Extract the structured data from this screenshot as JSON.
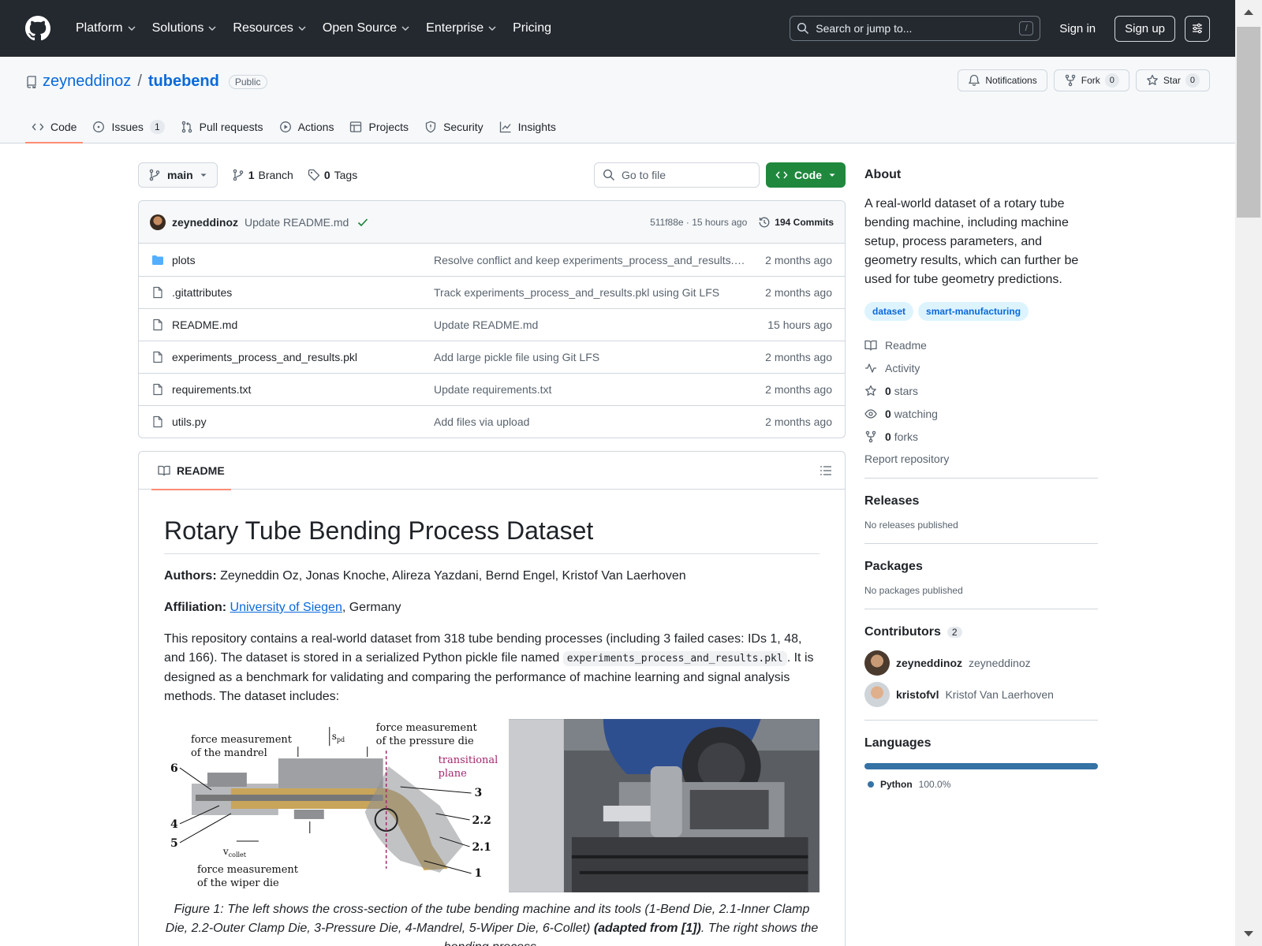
{
  "header": {
    "nav": [
      "Platform",
      "Solutions",
      "Resources",
      "Open Source",
      "Enterprise",
      "Pricing"
    ],
    "search_placeholder": "Search or jump to...",
    "slash": "/",
    "signin": "Sign in",
    "signup": "Sign up"
  },
  "repo": {
    "owner": "zeyneddinoz",
    "separator": "/",
    "name": "tubebend",
    "visibility": "Public",
    "actions": {
      "notifications": "Notifications",
      "fork": "Fork",
      "fork_count": "0",
      "star": "Star",
      "star_count": "0"
    },
    "tabs": [
      {
        "label": "Code"
      },
      {
        "label": "Issues",
        "count": "1"
      },
      {
        "label": "Pull requests"
      },
      {
        "label": "Actions"
      },
      {
        "label": "Projects"
      },
      {
        "label": "Security"
      },
      {
        "label": "Insights"
      }
    ]
  },
  "toolbar": {
    "branch": "main",
    "branches_count": "1",
    "branches_label": "Branch",
    "tags_count": "0",
    "tags_label": "Tags",
    "goto_placeholder": "Go to file",
    "code_label": "Code"
  },
  "commit": {
    "author": "zeyneddinoz",
    "message": "Update README.md",
    "hash_time": "511f88e · 15 hours ago",
    "commits_label": "194 Commits"
  },
  "files": [
    {
      "name": "plots",
      "type": "folder",
      "message": "Resolve conflict and keep experiments_process_and_results.pkl from remote",
      "date": "2 months ago"
    },
    {
      "name": ".gitattributes",
      "type": "file",
      "message": "Track experiments_process_and_results.pkl using Git LFS",
      "date": "2 months ago"
    },
    {
      "name": "README.md",
      "type": "file",
      "message": "Update README.md",
      "date": "15 hours ago"
    },
    {
      "name": "experiments_process_and_results.pkl",
      "type": "file",
      "message": "Add large pickle file using Git LFS",
      "date": "2 months ago"
    },
    {
      "name": "requirements.txt",
      "type": "file",
      "message": "Update requirements.txt",
      "date": "2 months ago"
    },
    {
      "name": "utils.py",
      "type": "file",
      "message": "Add files via upload",
      "date": "2 months ago"
    }
  ],
  "readme": {
    "tab": "README",
    "title": "Rotary Tube Bending Process Dataset",
    "authors_label": "Authors:",
    "authors": " Zeyneddin Oz, Jonas Knoche, Alireza Yazdani, Bernd Engel, Kristof Van Laerhoven",
    "affiliation_label": "Affiliation:",
    "affiliation_link": "University of Siegen",
    "affiliation_rest": ", Germany",
    "intro_before": "This repository contains a real-world dataset from 318 tube bending processes (including 3 failed cases: IDs 1, 48, and 166). The dataset is stored in a serialized Python pickle file named ",
    "intro_code": "experiments_process_and_results.pkl",
    "intro_after": ". It is designed as a benchmark for validating and comparing the performance of machine learning and signal analysis methods. The dataset includes:",
    "figure_labels": {
      "mandrel": [
        "force measurement",
        "of the mandrel"
      ],
      "pressure": [
        "force measurement",
        "of the pressure die"
      ],
      "wiper": [
        "force measurement",
        "of the wiper die"
      ],
      "spd": "s",
      "spd_sub": "pd",
      "plane": [
        "transitional",
        "plane"
      ],
      "vcollet": "v",
      "vcollet_sub": "collet",
      "numbers": [
        "6",
        "4",
        "5",
        "3",
        "2.2",
        "2.1",
        "1"
      ]
    },
    "caption_before": "Figure 1: The left shows the cross-section of the tube bending machine and its tools (1-Bend Die, 2.1-Inner Clamp Die, 2.2-Outer Clamp Die, 3-Pressure Die, 4-Mandrel, 5-Wiper Die, 6-Collet) ",
    "caption_bold": "(adapted from [1])",
    "caption_after": ". The right shows the bending process."
  },
  "about": {
    "title": "About",
    "description": "A real-world dataset of a rotary tube bending machine, including machine setup, process parameters, and geometry results, which can further be used for tube geometry predictions.",
    "topics": [
      "dataset",
      "smart-manufacturing"
    ],
    "links": [
      {
        "icon": "book-icon",
        "label": "Readme"
      },
      {
        "icon": "pulse-icon",
        "label": "Activity"
      },
      {
        "icon": "star-icon",
        "bold": "0",
        "label": "stars"
      },
      {
        "icon": "eye-icon",
        "bold": "0",
        "label": "watching"
      },
      {
        "icon": "fork-icon",
        "bold": "0",
        "label": "forks"
      }
    ],
    "report": "Report repository"
  },
  "releases": {
    "title": "Releases",
    "empty": "No releases published"
  },
  "packages": {
    "title": "Packages",
    "empty": "No packages published"
  },
  "contributors": {
    "title": "Contributors",
    "count": "2",
    "list": [
      {
        "login": "zeyneddinoz",
        "name": "zeyneddinoz"
      },
      {
        "login": "kristofvl",
        "name": "Kristof Van Laerhoven"
      }
    ]
  },
  "languages": {
    "title": "Languages",
    "list": [
      {
        "name": "Python",
        "percent": "100.0%",
        "share": 1.0,
        "color": "#3572A5"
      }
    ]
  },
  "colors": {
    "header_bg": "#24292f",
    "accent_blue": "#0969da",
    "green_button": "#1f883d",
    "tab_underline": "#fd8c73"
  }
}
